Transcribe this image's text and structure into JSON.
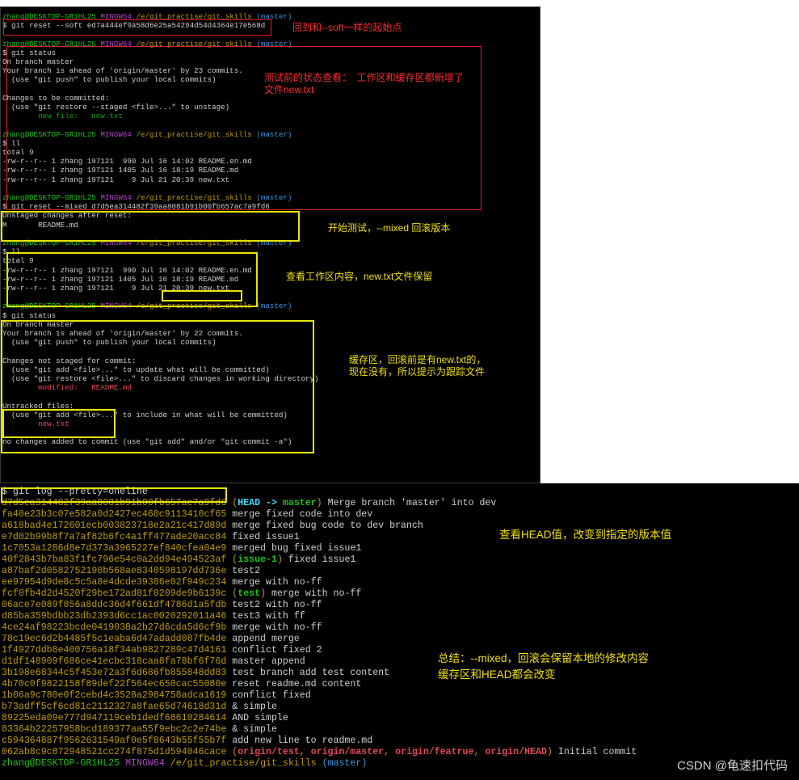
{
  "terminal_top": {
    "prompt_user": "zhang@DESKTOP-GR1HL25",
    "prompt_env": "MINGW64",
    "prompt_path": "/e/git_practise/git_skills",
    "prompt_branch": "(master)",
    "blocks": [
      {
        "cmd": "$ git reset --soft ed7a444ef9a58d6e25a54294d54d4364e17e568d",
        "output": []
      },
      {
        "cmd": "$ git status",
        "output": [
          "On branch master",
          "Your branch is ahead of 'origin/master' by 23 commits.",
          "  (use \"git push\" to publish your local commits)",
          "",
          "Changes to be committed:",
          "  (use \"git restore --staged <file>...\" to unstage)"
        ],
        "green": "        new file:   new.txt"
      },
      {
        "cmd": "$ ll",
        "output": [
          "total 9",
          "-rw-r--r-- 1 zhang 197121  990 Jul 16 14:02 README.en.md",
          "-rw-r--r-- 1 zhang 197121 1405 Jul 16 18:19 README.md",
          "-rw-r--r-- 1 zhang 197121    9 Jul 21 20:39 new.txt"
        ]
      },
      {
        "cmd": "$ git reset --mixed d7d5ea314482f39aa8081b91b00fb657ac7a9fd6",
        "output": [
          "Unstaged changes after reset:",
          "M       README.md"
        ]
      },
      {
        "cmd": "$ ll",
        "output": [
          "total 9",
          "-rw-r--r-- 1 zhang 197121  990 Jul 16 14:02 README.en.md",
          "-rw-r--r-- 1 zhang 197121 1405 Jul 16 18:19 README.md",
          "-rw-r--r-- 1 zhang 197121    9 Jul 21 20:39 new.txt"
        ]
      },
      {
        "cmd": "$ git status",
        "output": [
          "On branch master",
          "Your branch is ahead of 'origin/master' by 22 commits.",
          "  (use \"git push\" to publish your local commits)",
          "",
          "Changes not staged for commit:",
          "  (use \"git add <file>...\" to update what will be committed)",
          "  (use \"git restore <file>...\" to discard changes in working directory)"
        ],
        "red1": "        modified:   README.md",
        "output2": [
          "",
          "Untracked files:",
          "  (use \"git add <file>...\" to include in what will be committed)"
        ],
        "red2": "        new.txt",
        "output3": [
          "",
          "no changes added to commit (use \"git add\" and/or \"git commit -a\")"
        ]
      }
    ]
  },
  "terminal_bottom": {
    "cmd": "$ git log --pretty=oneline",
    "commits": [
      {
        "hash": "d7d5ea314482f39aa8081b91b00fb657ac7a9fd6",
        "refs": [
          {
            "t": "HEAD -> master",
            "c": "head"
          }
        ],
        "msg": "Merge branch 'master' into dev"
      },
      {
        "hash": "fa40e23b3c07e582a0d2427ec460c9113410cf65",
        "refs": [],
        "msg": "merge fixed code into dev"
      },
      {
        "hash": "a618bad4e172601ecb003823718e2a21c417d89d",
        "refs": [],
        "msg": "merge fixed bug code to dev branch"
      },
      {
        "hash": "e7d02b99b8f7a7af82b6fc4a1ff477ade20acc84",
        "refs": [],
        "msg": "fixed issue1"
      },
      {
        "hash": "1c7053a1286d8e7d373a3965227ef840cfea04e9",
        "refs": [],
        "msg": "merged bug fixed issue1"
      },
      {
        "hash": "40f2843b7ba83f1fc796e54c0a2dd94e494523af",
        "refs": [
          {
            "t": "issue-1",
            "c": "branch"
          }
        ],
        "msg": "fixed issue1"
      },
      {
        "hash": "a87baf2d0582752190b568ae8340598197dd736e",
        "refs": [],
        "msg": "test2"
      },
      {
        "hash": "ee97954d9de8c5c5a8e4dcde39386e02f949c234",
        "refs": [],
        "msg": "merge with no-ff"
      },
      {
        "hash": "fcf0fb4d2d4520f29be172ad81f0209de9b6139c",
        "refs": [
          {
            "t": "test",
            "c": "branch"
          }
        ],
        "msg": "merge with no-ff"
      },
      {
        "hash": "06ace7e089f856a8ddc36d4f661df4786d1a5fdb",
        "refs": [],
        "msg": "test2 with no-ff"
      },
      {
        "hash": "d85ba359bdbb23db2393d6cc1ac0020292011a46",
        "refs": [],
        "msg": "test3 with ff"
      },
      {
        "hash": "4ce24af98223bcde0419038a2b27d6cda5d6cf9b",
        "refs": [],
        "msg": "merge with no-ff"
      },
      {
        "hash": "78c19ec6d2b4485f5c1eaba6d47adadd087fb4de",
        "refs": [],
        "msg": "append merge"
      },
      {
        "hash": "1f4927ddb8e400756a18f34ab9827289c47d4161",
        "refs": [],
        "msg": "conflict fixed 2"
      },
      {
        "hash": "d1df148909f686ce41ecbc318caa8fa78bf6f76d",
        "refs": [],
        "msg": "master append"
      },
      {
        "hash": "3b198e68344c5f453e72a3f6d686fb855848dd83",
        "refs": [],
        "msg": "test branch add test content"
      },
      {
        "hash": "4b70c0f9822158f89def22f564ec650cac55080e",
        "refs": [],
        "msg": "reset readme.md content"
      },
      {
        "hash": "1b06a9c780e0f2cebd4c3528a2984758adca1619",
        "refs": [],
        "msg": "conflict fixed"
      },
      {
        "hash": "b73adff5cf6cd81c2112327a8fae65d74618d31d",
        "refs": [],
        "msg": "& simple"
      },
      {
        "hash": "89225eda09e777d947119ceb1dedf68610284614",
        "refs": [],
        "msg": "AND simple"
      },
      {
        "hash": "83364b22257958bcd189377aa55f9ebc2c2e74be",
        "refs": [],
        "msg": "& simple"
      },
      {
        "hash": "c594364887f9562631549af0e5f8643b55f55b7f",
        "refs": [],
        "msg": "add new line to readme.md"
      },
      {
        "hash": "062ab8c9c872948521cc274f875d1d594046cace",
        "refs": [
          {
            "t": "origin/test",
            "c": "remote"
          },
          {
            "t": "origin/master",
            "c": "remote"
          },
          {
            "t": "origin/featrue",
            "c": "remote"
          },
          {
            "t": "origin/HEAD",
            "c": "remote"
          }
        ],
        "msg": "Initial commit"
      }
    ],
    "final_prompt": "zhang@DESKTOP-GR1HL25 MINGW64 /e/git_practise/git_skills (master)"
  },
  "annotations": {
    "a1": "回到和--soft一样的起始点",
    "a2": "测试前的状态查看：  工作区和缓存区都新增了\n文件new.txt",
    "a3": "开始测试，--mixed 回滚版本",
    "a4": "查看工作区内容，new.txt文件保留",
    "a5": "缓存区，回滚前是有new.txt的，\n现在没有，所以提示为跟踪文件",
    "a6": "查看HEAD值，改变到指定的版本值",
    "a7": "总结：--mixed，回滚会保留本地的修改内容\n缓存区和HEAD都会改变"
  },
  "watermark": "CSDN @龟速扣代码",
  "colors": {
    "annotation_red": "#ff2a2a",
    "annotation_yellow": "#f0e000",
    "prompt_green": "#16c60c",
    "prompt_magenta": "#b148c6",
    "hash_yellow": "#c19c00"
  }
}
